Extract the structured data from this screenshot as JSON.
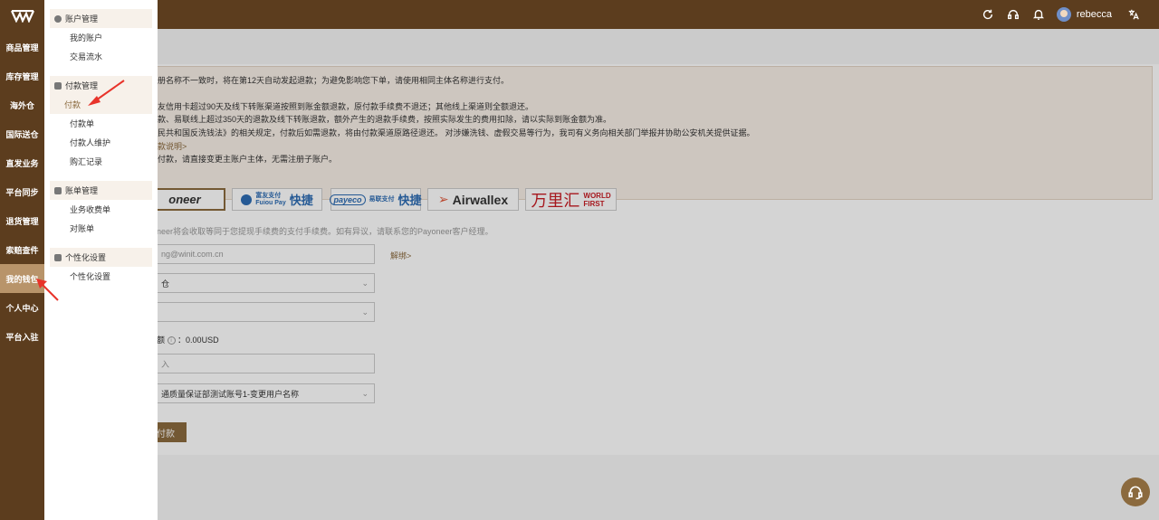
{
  "header": {
    "username": "rebecca",
    "icons": [
      "refresh-icon",
      "headset-icon",
      "bell-icon",
      "translate-icon"
    ]
  },
  "rail": {
    "items": [
      {
        "label": "商品管理"
      },
      {
        "label": "库存管理"
      },
      {
        "label": "海外仓"
      },
      {
        "label": "国际送仓"
      },
      {
        "label": "直发业务"
      },
      {
        "label": "平台同步"
      },
      {
        "label": "退货管理"
      },
      {
        "label": "索赔查件"
      },
      {
        "label": "我的钱包",
        "active": true
      },
      {
        "label": "个人中心"
      },
      {
        "label": "平台入驻"
      }
    ]
  },
  "menu": {
    "groups": [
      {
        "title": "账户管理",
        "items": [
          "我的账户",
          "交易流水"
        ]
      },
      {
        "title": "付款管理",
        "items": [
          "付款",
          "付款单",
          "付款人维护",
          "购汇记录"
        ]
      },
      {
        "title": "账单管理",
        "items": [
          "业务收费单",
          "对账单"
        ]
      },
      {
        "title": "个性化设置",
        "items": [
          "个性化设置"
        ]
      }
    ],
    "active_item": "付款"
  },
  "notice": {
    "line1": "册名称不一致时，将在第12天自动发起退款；为避免影响您下单，请使用相同主体名称进行支付。",
    "line2": "友信用卡超过90天及线下转账渠道按照到账金额退款，原付款手续费不退还；其他线上渠道则全额退还。",
    "line3": "款、易联线上超过350天的退款及线下转账退款，额外产生的退款手续费，按照实际发生的费用扣除，请以实际到账金额为准。",
    "line4": "民共和国反洗钱法》的相关规定，付款后如需退款，将由付款渠道原路径退还。 对涉嫌洗钱、虚假交易等行为，我司有义务向相关部门举报并协助公安机关提供证据。",
    "link": "款说明>",
    "line5": "付款，请直接变更主账户主体，无需注册子账户。"
  },
  "pay_channels": {
    "payoneer": "oneer",
    "fuiou_cn": "富友支付",
    "fuiou_en": "Fuiou Pay",
    "fuiou_fast": "快捷",
    "payeco": "payeco",
    "payeco_cn": "易联支付",
    "payeco_fast": "快捷",
    "airwallex": "Airwallex",
    "wlh_cn": "万里汇",
    "wlh_en1": "WORLD",
    "wlh_en2": "FIRST"
  },
  "form": {
    "hint": "neer将会收取等同于您提现手续费的支付手续费。如有异议，请联系您的Payoneer客户经理。",
    "email_placeholder": "ng@winit.com.cn",
    "unbind": "解绑>",
    "warehouse": "仓",
    "balance_label": "额",
    "balance_value": "：0.00USD",
    "amount_placeholder": "入",
    "account": "通质量保证部测试账号1-变更用户名称",
    "submit": "付款"
  }
}
